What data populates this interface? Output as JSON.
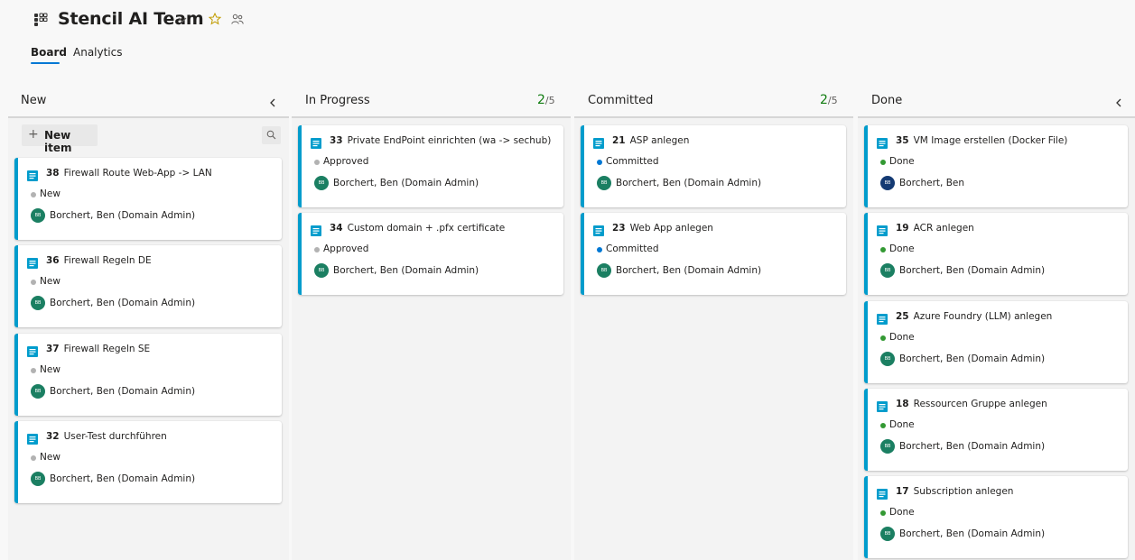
{
  "header": {
    "team_title": "Stencil AI Team",
    "tabs": [
      {
        "label": "Board",
        "selected": true
      },
      {
        "label": "Analytics",
        "selected": false
      }
    ]
  },
  "colors": {
    "accent": "#0078d4",
    "card_stripe": "#009ccc",
    "state_new": "#b2b2b2",
    "state_approved": "#b2b2b2",
    "state_committed": "#0078d4",
    "state_done": "#339933",
    "wip_count": "#107c10",
    "avatar": "#1b7f62",
    "avatar_dark": "#143a73"
  },
  "icons": {
    "team": "team-icon",
    "title_dropdown": "chevron-down-icon",
    "favorite": "star-icon",
    "members": "people-icon",
    "collapse": "chevron-left-icon",
    "new_item": "plus-icon",
    "search": "search-icon",
    "work_item": "backlog-item-icon"
  },
  "toolbar": {
    "new_item_label": "New item",
    "new_item_plus": "+"
  },
  "columns": [
    {
      "title": "New",
      "cards": [
        {
          "id": "38",
          "title": "Firewall Route Web-App -> LAN",
          "state": "New",
          "assignee": "Borchert, Ben (Domain Admin)",
          "initials": "BB"
        },
        {
          "id": "36",
          "title": "Firewall Regeln DE",
          "state": "New",
          "assignee": "Borchert, Ben (Domain Admin)",
          "initials": "BB"
        },
        {
          "id": "37",
          "title": "Firewall Regeln SE",
          "state": "New",
          "assignee": "Borchert, Ben (Domain Admin)",
          "initials": "BB"
        },
        {
          "id": "32",
          "title": "User-Test durchführen",
          "state": "New",
          "assignee": "Borchert, Ben (Domain Admin)",
          "initials": "BB"
        }
      ]
    },
    {
      "title": "In Progress",
      "count": "2",
      "limit": "/5",
      "cards": [
        {
          "id": "33",
          "title": "Private EndPoint einrichten (wa -> sechub)",
          "state": "Approved",
          "assignee": "Borchert, Ben (Domain Admin)",
          "initials": "BB"
        },
        {
          "id": "34",
          "title": "Custom domain + .pfx certificate",
          "state": "Approved",
          "assignee": "Borchert, Ben (Domain Admin)",
          "initials": "BB"
        }
      ]
    },
    {
      "title": "Committed",
      "count": "2",
      "limit": "/5",
      "cards": [
        {
          "id": "21",
          "title": "ASP anlegen",
          "state": "Committed",
          "assignee": "Borchert, Ben (Domain Admin)",
          "initials": "BB"
        },
        {
          "id": "23",
          "title": "Web App anlegen",
          "state": "Committed",
          "assignee": "Borchert, Ben (Domain Admin)",
          "initials": "BB"
        }
      ]
    },
    {
      "title": "Done",
      "cards": [
        {
          "id": "35",
          "title": "VM Image erstellen (Docker File)",
          "state": "Done",
          "assignee": "Borchert, Ben",
          "initials": "BB"
        },
        {
          "id": "19",
          "title": "ACR anlegen",
          "state": "Done",
          "assignee": "Borchert, Ben (Domain Admin)",
          "initials": "BB"
        },
        {
          "id": "25",
          "title": "Azure Foundry (LLM) anlegen",
          "state": "Done",
          "assignee": "Borchert, Ben (Domain Admin)",
          "initials": "BB"
        },
        {
          "id": "18",
          "title": "Ressourcen Gruppe anlegen",
          "state": "Done",
          "assignee": "Borchert, Ben (Domain Admin)",
          "initials": "BB"
        },
        {
          "id": "17",
          "title": "Subscription anlegen",
          "state": "Done",
          "assignee": "Borchert, Ben (Domain Admin)",
          "initials": "BB"
        }
      ]
    }
  ]
}
